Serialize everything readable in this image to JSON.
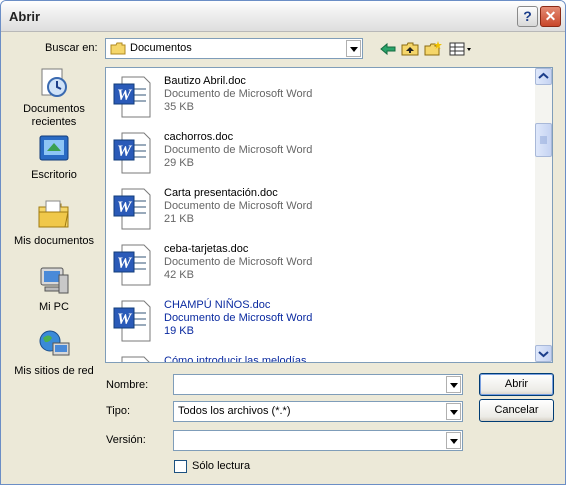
{
  "window": {
    "title": "Abrir",
    "help_glyph": "?",
    "close_glyph": "✕"
  },
  "lookin": {
    "label": "Buscar en:",
    "value": "Documentos"
  },
  "toolbar": {
    "icons": [
      "back-arrow-icon",
      "up-folder-icon",
      "new-folder-icon",
      "view-menu-icon"
    ]
  },
  "places": [
    {
      "id": "recent",
      "label_line1": "Documentos",
      "label_line2": "recientes",
      "icon": "recent-documents-icon"
    },
    {
      "id": "desktop",
      "label_line1": "Escritorio",
      "label_line2": "",
      "icon": "desktop-icon"
    },
    {
      "id": "mydocs",
      "label_line1": "Mis documentos",
      "label_line2": "",
      "icon": "my-documents-icon"
    },
    {
      "id": "mypc",
      "label_line1": "Mi PC",
      "label_line2": "",
      "icon": "my-computer-icon"
    },
    {
      "id": "network",
      "label_line1": "Mis sitios de red",
      "label_line2": "",
      "icon": "network-places-icon"
    }
  ],
  "files": [
    {
      "name": "Bautizo Abril.doc",
      "type": "Documento de Microsoft Word",
      "size": "35 KB"
    },
    {
      "name": "cachorros.doc",
      "type": "Documento de Microsoft Word",
      "size": "29 KB"
    },
    {
      "name": "Carta presentación.doc",
      "type": "Documento de Microsoft Word",
      "size": "21 KB"
    },
    {
      "name": "ceba-tarjetas.doc",
      "type": "Documento de Microsoft Word",
      "size": "42 KB"
    },
    {
      "name": "CHAMPÚ   NIÑOS.doc",
      "type": "Documento de Microsoft Word",
      "size": "19 KB"
    },
    {
      "name": "Cómo introducir las melodías",
      "type": "",
      "size": ""
    }
  ],
  "form": {
    "name_label": "Nombre:",
    "name_value": "",
    "type_label": "Tipo:",
    "type_value": "Todos los archivos (*.*)",
    "version_label": "Versión:",
    "version_value": "",
    "readonly_label": "Sólo lectura"
  },
  "buttons": {
    "open": "Abrir",
    "cancel": "Cancelar"
  }
}
